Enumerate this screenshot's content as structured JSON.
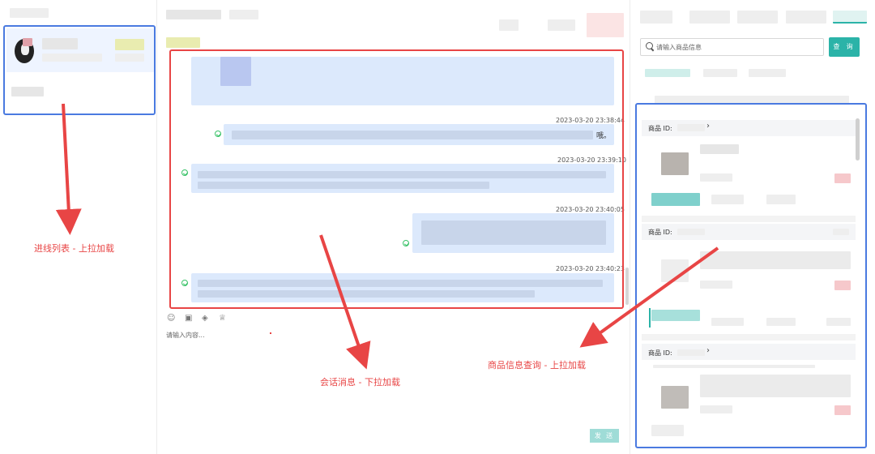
{
  "chat": {
    "messages": [
      {
        "time": ""
      },
      {
        "time": "2023-03-20 23:38:44",
        "tail": "哦。"
      },
      {
        "time": "2023-03-20 23:39:10"
      },
      {
        "time": "2023-03-20 23:40:05"
      },
      {
        "time": "2023-03-20 23:40:23"
      }
    ],
    "input_placeholder": "请输入内容...",
    "send_label": "发 送"
  },
  "products": {
    "search_placeholder": "请输入商品信息",
    "query_label": "查 询",
    "items": [
      {
        "id_label": "商品 ID:"
      },
      {
        "id_label": "商品 ID:"
      },
      {
        "id_label": "商品 ID:"
      }
    ]
  },
  "annotations": {
    "left": "进线列表 - 上拉加载",
    "middle": "会话消息 - 下拉加载",
    "right": "商品信息查询 - 上拉加载"
  },
  "colors": {
    "annotation": "#e84545",
    "highlight_box": "#4a7ae0",
    "accent": "#2bb3a8",
    "bubble": "#dce9fc"
  }
}
